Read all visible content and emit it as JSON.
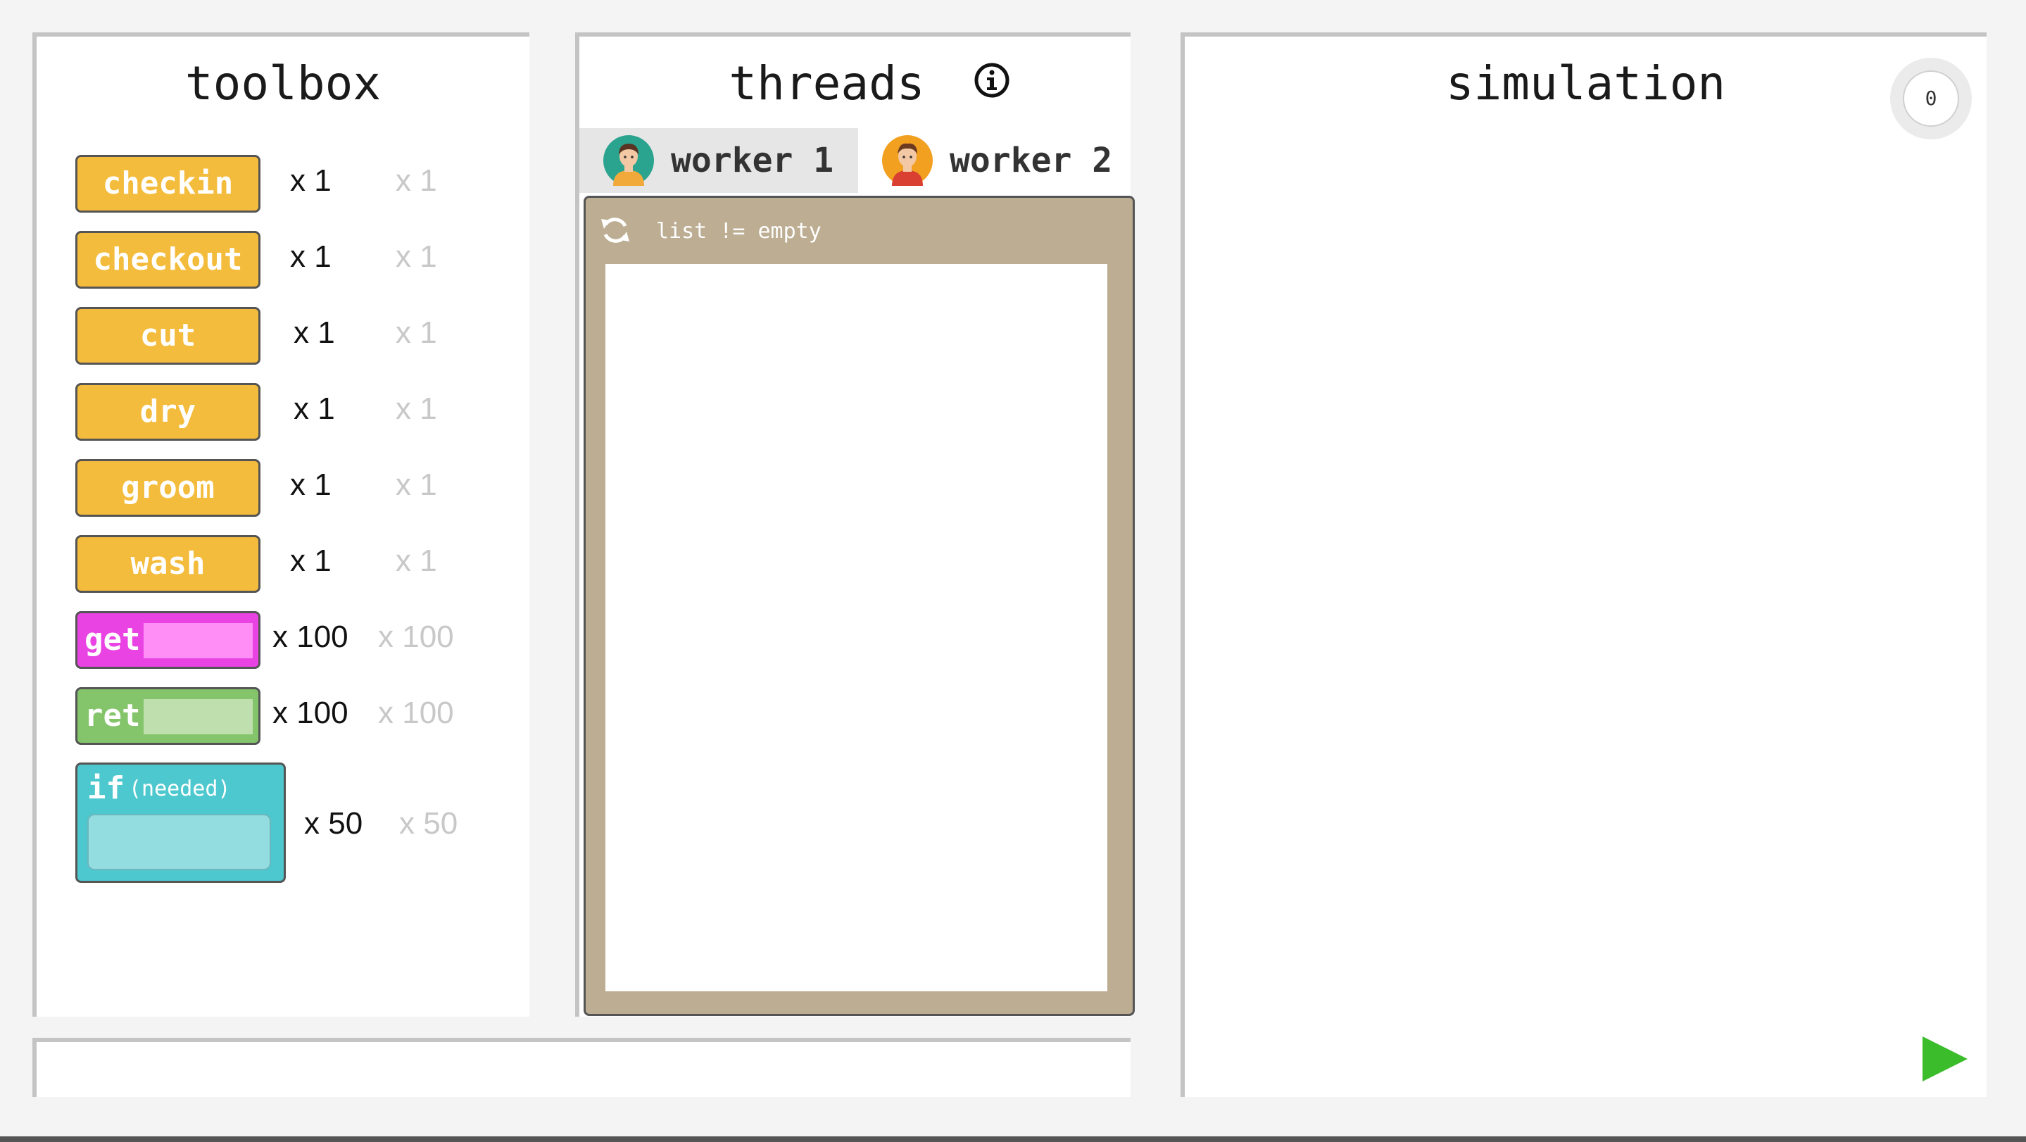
{
  "toolbox": {
    "title": "toolbox",
    "tools": [
      {
        "label": "checkin",
        "count": "x 1",
        "ghost": "x 1"
      },
      {
        "label": "checkout",
        "count": "x 1",
        "ghost": "x 1"
      },
      {
        "label": "cut",
        "count": "x 1",
        "ghost": "x 1"
      },
      {
        "label": "dry",
        "count": "x 1",
        "ghost": "x 1"
      },
      {
        "label": "groom",
        "count": "x 1",
        "ghost": "x 1"
      },
      {
        "label": "wash",
        "count": "x 1",
        "ghost": "x 1"
      },
      {
        "label": "get",
        "count": "x 100",
        "ghost": "x 100"
      },
      {
        "label": "ret",
        "count": "x 100",
        "ghost": "x 100"
      },
      {
        "label": "if",
        "note": "(needed)",
        "count": "x 50",
        "ghost": "x 50"
      }
    ]
  },
  "threads": {
    "title": "threads",
    "info_icon": "info-icon",
    "tabs": [
      {
        "label": "worker 1",
        "active": true
      },
      {
        "label": "worker 2",
        "active": false
      }
    ],
    "loop": {
      "icon": "loop-icon",
      "condition": "list != empty"
    }
  },
  "simulation": {
    "title": "simulation",
    "tick": "0",
    "play_icon": "play-icon"
  },
  "colors": {
    "action_block": "#f4bc3c",
    "get_block": "#e944e3",
    "ret_block": "#84c46a",
    "if_block": "#4ec8cf",
    "loop_block": "#bdad92",
    "play": "#3bbd2b"
  }
}
